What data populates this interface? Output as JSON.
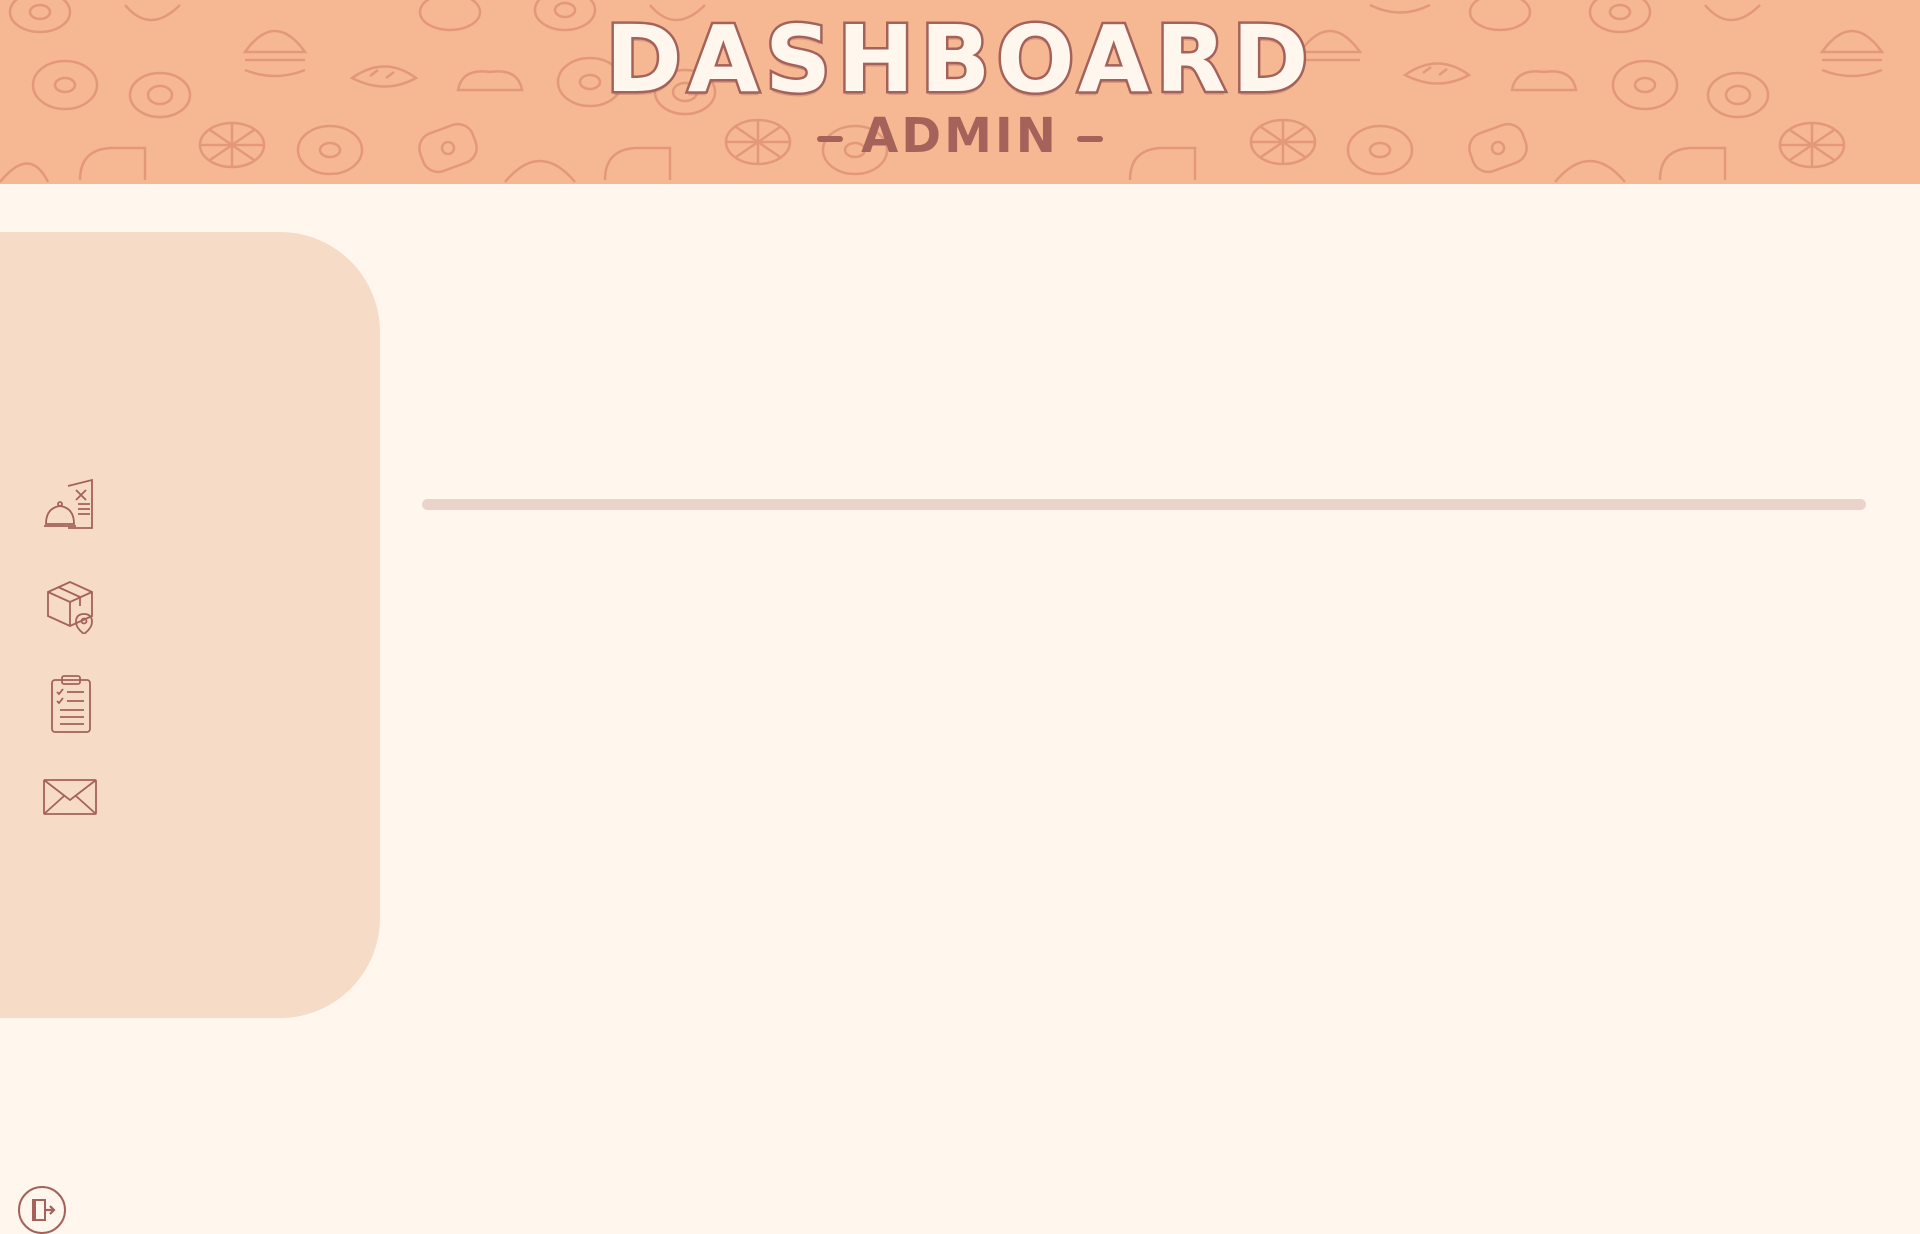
{
  "header": {
    "title": "DASHBOARD",
    "subtitle": "ADMIN"
  },
  "sidebar": {
    "items": [
      {
        "name": "menu",
        "icon": "menu-cloche-icon"
      },
      {
        "name": "delivery",
        "icon": "package-location-icon"
      },
      {
        "name": "orders",
        "icon": "clipboard-checklist-icon"
      },
      {
        "name": "messages",
        "icon": "mail-envelope-icon"
      }
    ],
    "logout_icon": "logout-door-icon"
  },
  "colors": {
    "header_bg": "#f6b893",
    "page_bg": "#fff7ee",
    "sidebar_bg": "#f6dcc7",
    "accent": "#a4625a",
    "divider": "#ebd3cc"
  }
}
